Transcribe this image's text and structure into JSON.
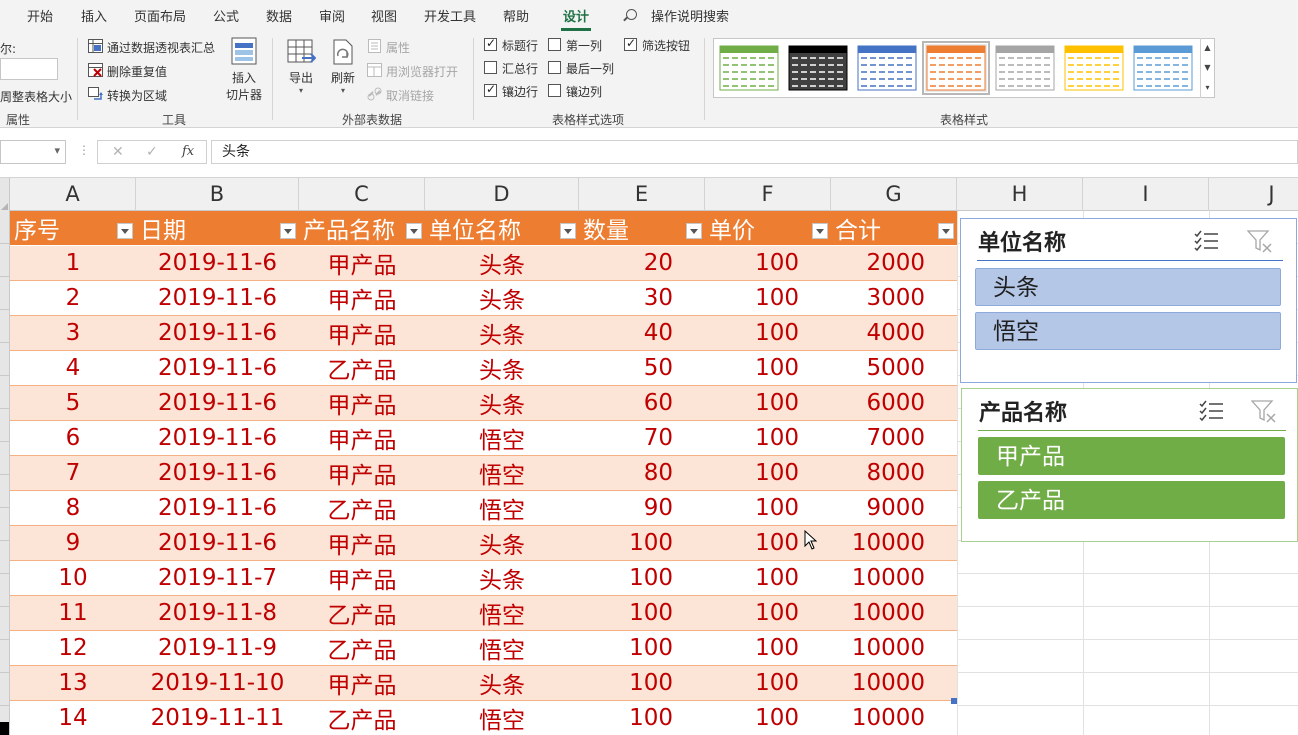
{
  "ribbon_tabs": [
    "开始",
    "插入",
    "页面布局",
    "公式",
    "数据",
    "审阅",
    "视图",
    "开发工具",
    "帮助",
    "设计"
  ],
  "active_tab": "设计",
  "tell_me": "操作说明搜索",
  "groups": {
    "properties": {
      "label": "属性",
      "name_label_fragment": "尔:",
      "resize_fragment": "周整表格大小"
    },
    "tools": {
      "label": "工具",
      "pivot": "通过数据透视表汇总",
      "remove_dup": "删除重复值",
      "convert": "转换为区域",
      "slicer_l1": "插入",
      "slicer_l2": "切片器"
    },
    "external": {
      "label": "外部表数据",
      "export": "导出",
      "refresh": "刷新",
      "properties": "属性",
      "open_browser": "用浏览器打开",
      "unlink": "取消链接"
    },
    "style_options": {
      "label": "表格样式选项",
      "header_row": {
        "label": "标题行",
        "checked": true
      },
      "total_row": {
        "label": "汇总行",
        "checked": false
      },
      "banded_rows": {
        "label": "镶边行",
        "checked": true
      },
      "first_col": {
        "label": "第一列",
        "checked": false
      },
      "last_col": {
        "label": "最后一列",
        "checked": false
      },
      "banded_cols": {
        "label": "镶边列",
        "checked": false
      },
      "filter_btn": {
        "label": "筛选按钮",
        "checked": true
      }
    },
    "table_styles": {
      "label": "表格样式",
      "swatch_colors": [
        "#70ad47",
        "#000000",
        "#4472c4",
        "#ed7d31",
        "#a5a5a5",
        "#ffc000",
        "#5b9bd5"
      ],
      "selected_index": 3
    }
  },
  "formula_bar": {
    "name_box": "",
    "fx": "fx",
    "content": "头条"
  },
  "column_headers": [
    "A",
    "B",
    "C",
    "D",
    "E",
    "F",
    "G",
    "H",
    "I",
    "J"
  ],
  "table": {
    "accent": "#ed7d31",
    "band": "#fce4d6",
    "text_color": "#c00000",
    "headers": [
      "序号",
      "日期",
      "产品名称",
      "单位名称",
      "数量",
      "单价",
      "合计"
    ],
    "rows": [
      [
        "1",
        "2019-11-6",
        "甲产品",
        "头条",
        "20",
        "100",
        "2000"
      ],
      [
        "2",
        "2019-11-6",
        "甲产品",
        "头条",
        "30",
        "100",
        "3000"
      ],
      [
        "3",
        "2019-11-6",
        "甲产品",
        "头条",
        "40",
        "100",
        "4000"
      ],
      [
        "4",
        "2019-11-6",
        "乙产品",
        "头条",
        "50",
        "100",
        "5000"
      ],
      [
        "5",
        "2019-11-6",
        "甲产品",
        "头条",
        "60",
        "100",
        "6000"
      ],
      [
        "6",
        "2019-11-6",
        "甲产品",
        "悟空",
        "70",
        "100",
        "7000"
      ],
      [
        "7",
        "2019-11-6",
        "甲产品",
        "悟空",
        "80",
        "100",
        "8000"
      ],
      [
        "8",
        "2019-11-6",
        "乙产品",
        "悟空",
        "90",
        "100",
        "9000"
      ],
      [
        "9",
        "2019-11-6",
        "甲产品",
        "头条",
        "100",
        "100",
        "10000"
      ],
      [
        "10",
        "2019-11-7",
        "甲产品",
        "头条",
        "100",
        "100",
        "10000"
      ],
      [
        "11",
        "2019-11-8",
        "乙产品",
        "悟空",
        "100",
        "100",
        "10000"
      ],
      [
        "12",
        "2019-11-9",
        "乙产品",
        "悟空",
        "100",
        "100",
        "10000"
      ],
      [
        "13",
        "2019-11-10",
        "甲产品",
        "头条",
        "100",
        "100",
        "10000"
      ],
      [
        "14",
        "2019-11-11",
        "乙产品",
        "悟空",
        "100",
        "100",
        "10000"
      ]
    ]
  },
  "slicers": [
    {
      "title": "单位名称",
      "items": [
        "头条",
        "悟空"
      ],
      "item_bg": "#b4c7e7",
      "item_border": "#8ea9db",
      "item_text": "#1f1f1f",
      "line_color": "#4472c4",
      "border": "#8ea9db"
    },
    {
      "title": "产品名称",
      "items": [
        "甲产品",
        "乙产品"
      ],
      "item_bg": "#70ad47",
      "item_border": "#70ad47",
      "item_text": "#ffffff",
      "line_color": "#70ad47",
      "border": "#a9d08e"
    }
  ]
}
